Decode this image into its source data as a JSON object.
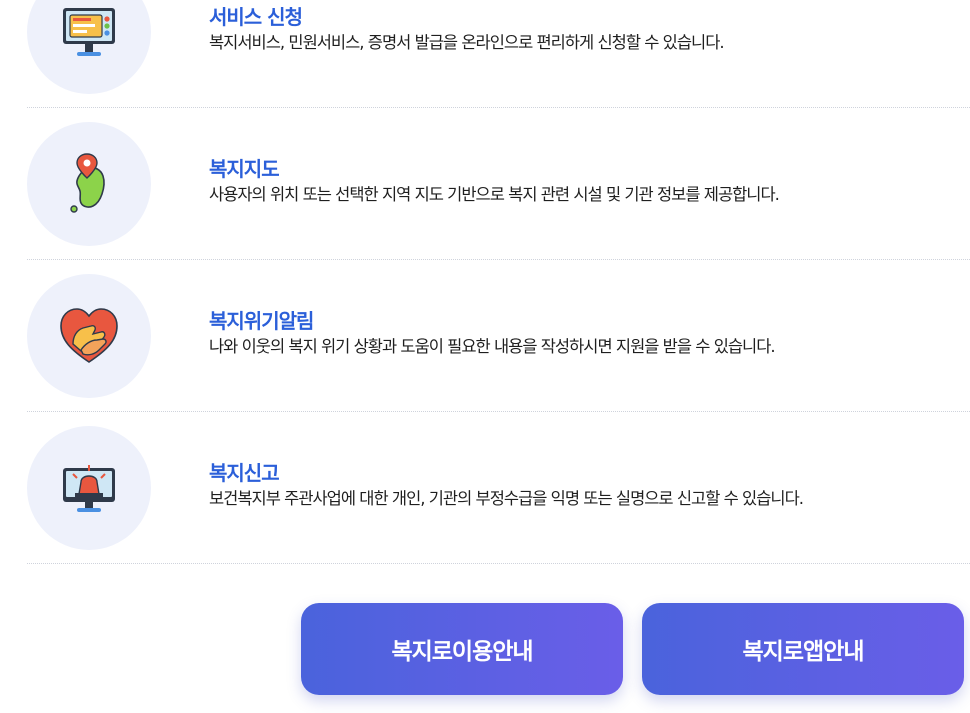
{
  "services": [
    {
      "icon": "application-monitor-icon",
      "title": "서비스 신청",
      "description": "복지서비스, 민원서비스, 증명서 발급을 온라인으로 편리하게 신청할 수 있습니다."
    },
    {
      "icon": "korea-map-pin-icon",
      "title": "복지지도",
      "description": "사용자의 위치 또는 선택한 지역 지도 기반으로 복지 관련 시설 및 기관 정보를 제공합니다."
    },
    {
      "icon": "heart-hands-icon",
      "title": "복지위기알림",
      "description": "나와 이웃의 복지 위기 상황과 도움이 필요한 내용을 작성하시면 지원을 받을 수 있습니다."
    },
    {
      "icon": "siren-monitor-icon",
      "title": "복지신고",
      "description": "보건복지부 주관사업에 대한 개인, 기관의 부정수급을 익명 또는 실명으로 신고할 수 있습니다."
    }
  ],
  "buttons": {
    "usage_guide": "복지로이용안내",
    "app_guide": "복지로앱안내"
  },
  "colors": {
    "title_blue": "#2b5fd9",
    "circle_bg": "#eef1fb",
    "button_gradient_start": "#4a63dc",
    "button_gradient_end": "#6a5ee8"
  }
}
